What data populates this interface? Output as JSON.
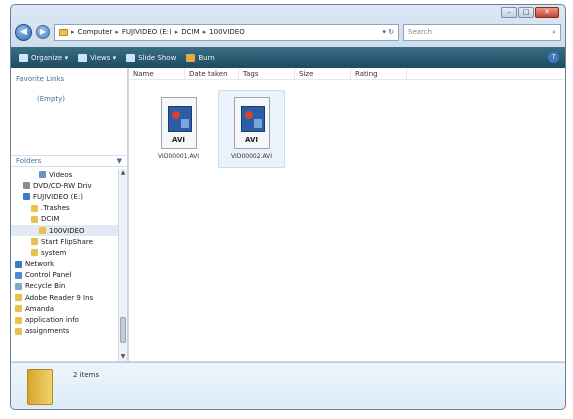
{
  "window": {
    "caption_buttons": [
      "–",
      "□",
      "✕"
    ]
  },
  "address_bar": {
    "crumbs": [
      "Computer",
      "FUJIVIDEO (E:)",
      "DCIM",
      "100VIDEO"
    ],
    "separator": "▸",
    "search_placeholder": "Search"
  },
  "toolbar": {
    "organize": "Organize ▾",
    "views": "Views ▾",
    "slideshow": "Slide Show",
    "burn": "Burn"
  },
  "nav_pane": {
    "favorite_links_title": "Favorite Links",
    "favorites_empty": "(Empty)",
    "folders_label": "Folders",
    "tree": [
      {
        "label": "Videos",
        "icon": "videos-icon",
        "indent": 3,
        "color": "#6b8fc7"
      },
      {
        "label": "DVD/CD-RW Driv",
        "icon": "dvd-drive-icon",
        "indent": 1,
        "color": "#8c8c8c"
      },
      {
        "label": "FUJIVIDEO (E:)",
        "icon": "drive-icon",
        "indent": 1,
        "color": "#3b7cc7"
      },
      {
        "label": ".Trashes",
        "icon": "folder-icon",
        "indent": 2,
        "color": "#e8c24a"
      },
      {
        "label": "DCIM",
        "icon": "folder-icon",
        "indent": 2,
        "color": "#e8c24a"
      },
      {
        "label": "100VIDEO",
        "icon": "folder-icon",
        "indent": 3,
        "color": "#e8c24a",
        "selected": true
      },
      {
        "label": "Start FlipShare",
        "icon": "folder-icon",
        "indent": 2,
        "color": "#e8c24a"
      },
      {
        "label": "system",
        "icon": "folder-icon",
        "indent": 2,
        "color": "#e8c24a"
      },
      {
        "label": "Network",
        "icon": "network-icon",
        "indent": 0,
        "color": "#3b7cc7"
      },
      {
        "label": "Control Panel",
        "icon": "control-panel-icon",
        "indent": 0,
        "color": "#4b8bd6"
      },
      {
        "label": "Recycle Bin",
        "icon": "recycle-bin-icon",
        "indent": 0,
        "color": "#7fa6c9"
      },
      {
        "label": "Adobe Reader 9 Ins",
        "icon": "folder-icon",
        "indent": 0,
        "color": "#e8c24a"
      },
      {
        "label": "Amanda",
        "icon": "folder-icon",
        "indent": 0,
        "color": "#e8c24a"
      },
      {
        "label": "application info",
        "icon": "folder-icon",
        "indent": 0,
        "color": "#e8c24a"
      },
      {
        "label": "assignments",
        "icon": "folder-icon",
        "indent": 0,
        "color": "#e8c24a"
      }
    ]
  },
  "columns": [
    "Name",
    "Date taken",
    "Tags",
    "Size",
    "Rating"
  ],
  "files": [
    {
      "name": "VID00001.AVI",
      "type": "AVI"
    },
    {
      "name": "VID00002.AVI",
      "type": "AVI"
    }
  ],
  "details": {
    "items_count": "2 items"
  }
}
